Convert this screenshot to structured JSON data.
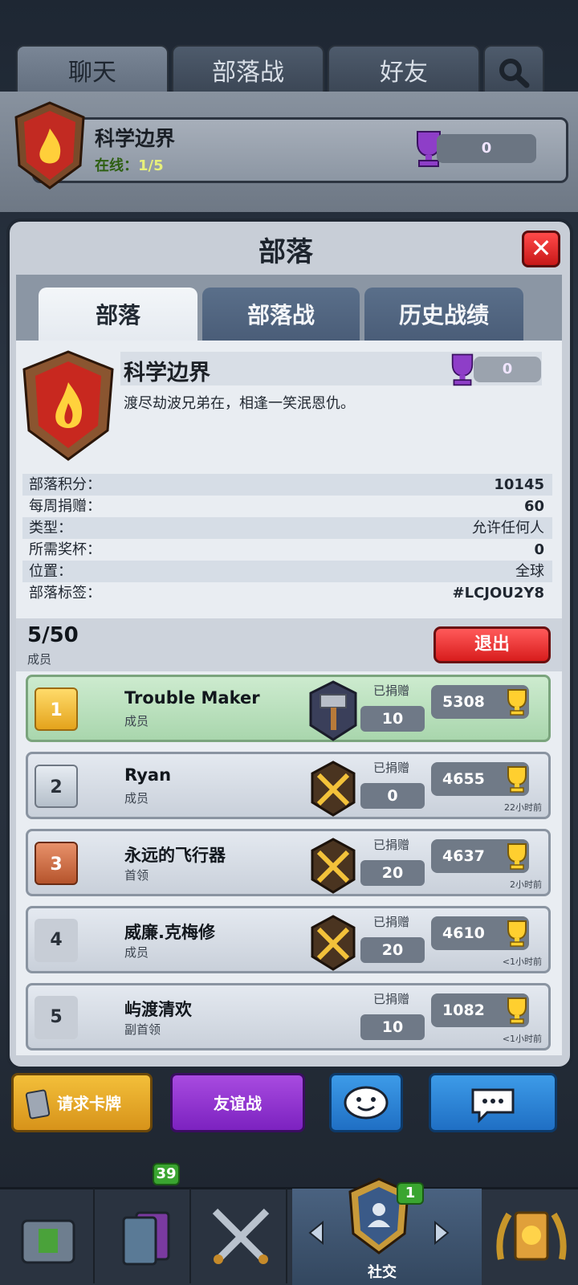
{
  "top_tabs": [
    "聊天",
    "部落战",
    "好友"
  ],
  "chat_clan": {
    "name": "科学边界",
    "online_label": "在线：",
    "online_value": "1/5",
    "trophies": "0"
  },
  "modal": {
    "title": "部落",
    "close": "✕"
  },
  "sub_tabs": [
    "部落",
    "部落战",
    "历史战绩"
  ],
  "clan": {
    "name": "科学边界",
    "description": "渡尽劫波兄弟在，相逢一笑泯恩仇。",
    "war_trophies": "0",
    "stats": [
      {
        "label": "部落积分：",
        "value": "10145"
      },
      {
        "label": "每周捐赠：",
        "value": "60"
      },
      {
        "label": "类型：",
        "value": "允许任何人"
      },
      {
        "label": "所需奖杯：",
        "value": "0"
      },
      {
        "label": "位置：",
        "value": "全球"
      },
      {
        "label": "部落标签：",
        "value": "#LCJOU2Y8"
      }
    ]
  },
  "members": {
    "count": "5/50",
    "label": "成员",
    "exit": "退出",
    "donated_label": "已捐赠",
    "list": [
      {
        "rank": "1",
        "name": "Trouble Maker",
        "role": "成员",
        "donated": "10",
        "trophies": "5308",
        "last_seen": ""
      },
      {
        "rank": "2",
        "name": "Ryan",
        "role": "成员",
        "donated": "0",
        "trophies": "4655",
        "last_seen": "22小时前"
      },
      {
        "rank": "3",
        "name": "永远的飞行器",
        "role": "首领",
        "donated": "20",
        "trophies": "4637",
        "last_seen": "2小时前"
      },
      {
        "rank": "4",
        "name": "威廉.克梅修",
        "role": "成员",
        "donated": "20",
        "trophies": "4610",
        "last_seen": "<1小时前"
      },
      {
        "rank": "5",
        "name": "屿渡清欢",
        "role": "副首领",
        "donated": "10",
        "trophies": "1082",
        "last_seen": "<1小时前"
      }
    ]
  },
  "actions": {
    "request_cards": "请求卡牌",
    "friendly_battle": "友谊战"
  },
  "nav": {
    "cards_badge": "39",
    "social_badge": "1",
    "social_label": "社交"
  },
  "colors": {
    "accent_red": "#e02424",
    "row_green": "#a9d6ad",
    "purple_button": "#8a2bd0",
    "blue_button": "#2a7ed0",
    "yellow_button": "#e6a51c"
  }
}
